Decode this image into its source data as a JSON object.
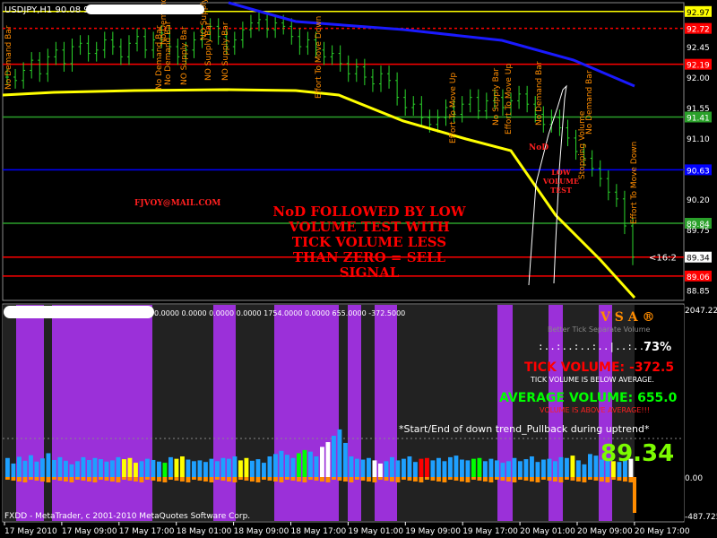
{
  "window": {
    "symbol_header": "USDJPY,H1  90.08 90.10 88.95 89.34",
    "footer": "FXDD - MetaTrader, c 2001-2010 MetaQuotes Software Corp."
  },
  "main_chart": {
    "price_ticks": [
      "92.45",
      "92.00",
      "91.55",
      "91.10",
      "90.20",
      "89.75",
      "88.85"
    ],
    "level_tags": [
      {
        "label": "92.97",
        "price": 92.97,
        "color": "#ffff00",
        "text_color": "#000000"
      },
      {
        "label": "92.72",
        "price": 92.72,
        "color": "#ff0000",
        "text_color": "#ffffff",
        "dashed": true
      },
      {
        "label": "92.19",
        "price": 92.19,
        "color": "#ff0000",
        "text_color": "#ffffff"
      },
      {
        "label": "91.41",
        "price": 91.41,
        "color": "#2aa02a",
        "text_color": "#ffffff"
      },
      {
        "label": "90.63",
        "price": 90.63,
        "color": "#0000ff",
        "text_color": "#ffffff"
      },
      {
        "label": "89.84",
        "price": 89.84,
        "color": "#2aa02a",
        "text_color": "#ffffff"
      },
      {
        "label": "89.34",
        "price": 89.34,
        "color": "#ffffff",
        "text_color": "#000000"
      },
      {
        "label": "89.06",
        "price": 89.06,
        "color": "#ff0000",
        "text_color": "#ffffff"
      }
    ],
    "timer_label": "<16:2",
    "email": "FJVOY@MAIL.COM",
    "signal_text": [
      "NoD FOLLOWED BY LOW",
      "VOLUME TEST WITH",
      "TICK VOLUME LESS",
      "THAN ZERO = SELL",
      "SIGNAL"
    ],
    "nod_label": "NoD",
    "low_volume_test": [
      "LOW",
      "VOLUME",
      "TEST"
    ],
    "vertical_annotations": [
      {
        "text": "No Demand Bar"
      },
      {
        "text": "No Demand Bar"
      },
      {
        "text": "No Demand Bar"
      },
      {
        "text": "NO Supply Bar"
      },
      {
        "text": "NO Supply Bar"
      },
      {
        "text": "NO Supply Bar"
      },
      {
        "text": "No Demand Bar"
      },
      {
        "text": "NO Supply Bar"
      },
      {
        "text": "Effort To Move Down"
      },
      {
        "text": "Effort To Move Up"
      },
      {
        "text": "Effort To Move Up"
      },
      {
        "text": "No Supply Bar"
      },
      {
        "text": "No Demand Bar"
      },
      {
        "text": "Stopping Volume"
      },
      {
        "text": "No Demand Bar"
      },
      {
        "text": "Effort To Move Down"
      }
    ]
  },
  "volume_panel": {
    "header_values": "0.0000 0.0000 0.0000 0.0000 1754.0000 0.0000 655.0000 -372.5000",
    "scale_ticks": [
      "2047.225",
      "0.00",
      "-487.725"
    ],
    "vsa_title": "V  S  A  ®",
    "subtitle": "Better Tick Separate Volume",
    "dots": ":..:..:..:..|..:..:",
    "percent": "73%",
    "tick_volume": "TICK VOLUME: -372.5",
    "tick_note": "TICK VOLUME IS BELOW AVERAGE.",
    "avg_volume": "AVERAGE VOLUME: 655.0",
    "avg_note": "VOLUME IS ABOVE AVERAGE!!!",
    "trend_note": "*Start/End of down trend_Pullback during uptrend*",
    "price": "89.34",
    "colors": {
      "tick": "#ff0000",
      "avg": "#00ff00",
      "vsa": "#ff8c00",
      "price": "#7cfc00"
    }
  },
  "time_axis": [
    "17 May 2010",
    "17 May 09:00",
    "17 May 17:00",
    "18 May 01:00",
    "18 May 09:00",
    "18 May 17:00",
    "19 May 01:00",
    "19 May 09:00",
    "19 May 17:00",
    "20 May 01:00",
    "20 May 09:00",
    "20 May 17:00"
  ],
  "chart_data": {
    "type": "candlestick",
    "symbol": "USDJPY,H1",
    "ohlc": [
      90.08,
      90.1,
      88.95,
      89.34
    ],
    "ylim": [
      88.7,
      93.1
    ],
    "close_series": [
      92.0,
      91.95,
      92.1,
      92.25,
      92.05,
      92.3,
      92.4,
      92.2,
      92.45,
      92.5,
      92.35,
      92.4,
      92.55,
      92.45,
      92.3,
      92.5,
      92.6,
      92.4,
      92.55,
      92.65,
      92.45,
      92.3,
      92.4,
      92.55,
      92.65,
      92.75,
      92.6,
      92.45,
      92.55,
      92.7,
      92.8,
      92.85,
      92.7,
      92.8,
      92.75,
      92.6,
      92.45,
      92.55,
      92.4,
      92.3,
      92.35,
      92.2,
      92.05,
      92.15,
      92.0,
      91.9,
      92.05,
      91.95,
      91.7,
      91.55,
      91.6,
      91.4,
      91.3,
      91.4,
      91.55,
      91.45,
      91.6,
      91.7,
      91.5,
      91.65,
      91.7,
      91.55,
      91.65,
      91.75,
      91.6,
      91.45,
      91.3,
      91.4,
      91.25,
      91.1,
      90.9,
      90.8,
      90.65,
      90.5,
      90.3,
      90.2,
      89.8,
      89.34
    ],
    "volume_bars": [
      240,
      170,
      255,
      205,
      275,
      195,
      235,
      300,
      215,
      250,
      205,
      160,
      200,
      250,
      215,
      240,
      225,
      195,
      210,
      250,
      225,
      240,
      180,
      200,
      230,
      215,
      195,
      180,
      250,
      230,
      260,
      220,
      200,
      210,
      190,
      230,
      200,
      240,
      230,
      260,
      210,
      240,
      205,
      225,
      180,
      260,
      290,
      330,
      280,
      240,
      300,
      340,
      320,
      260,
      380,
      440,
      520,
      600,
      430,
      260,
      230,
      220,
      240,
      210,
      170,
      200,
      250,
      210,
      230,
      260,
      190,
      230,
      240,
      210,
      240,
      200,
      250,
      270,
      220,
      210,
      230,
      240,
      200,
      230,
      210,
      180,
      200,
      240,
      200,
      225,
      260,
      190,
      220,
      230,
      200,
      250,
      240,
      270,
      210,
      160,
      290,
      270,
      220,
      240,
      200,
      190,
      225,
      230
    ],
    "average_volume": 655.0,
    "tick_volume": -372.5
  }
}
